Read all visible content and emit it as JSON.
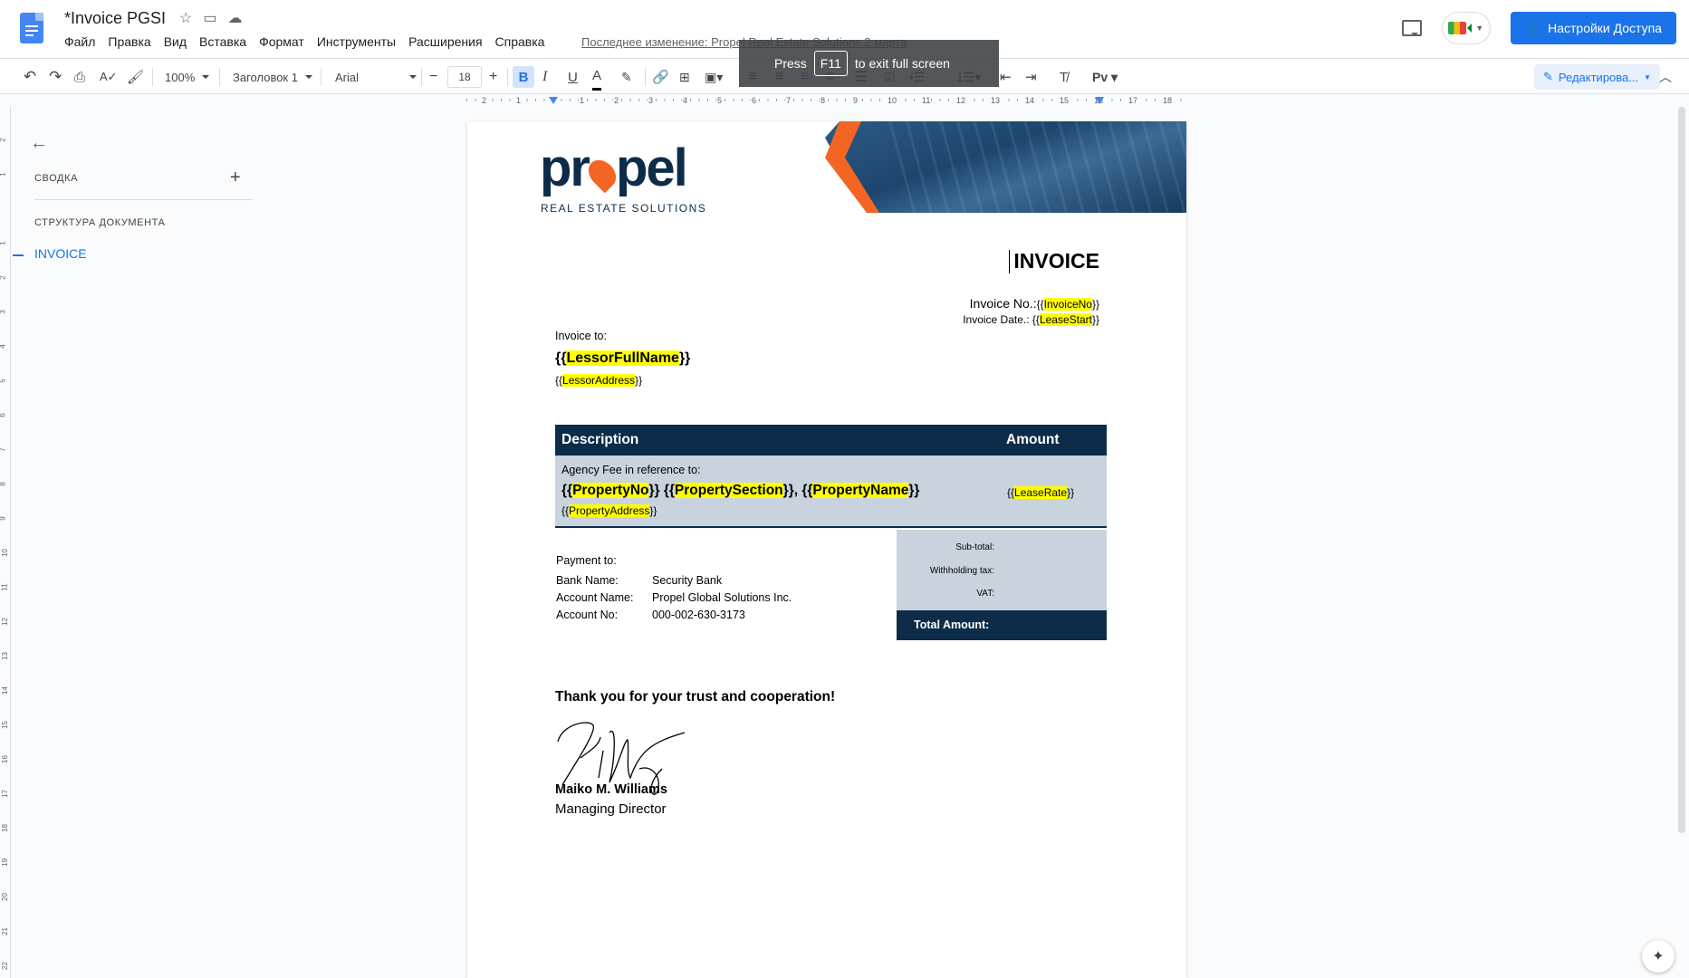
{
  "header": {
    "doc_title": "*Invoice PGSI",
    "menu": [
      "Файл",
      "Правка",
      "Вид",
      "Вставка",
      "Формат",
      "Инструменты",
      "Расширения",
      "Справка"
    ],
    "last_edit": "Последнее изменение: Propel Real Estate Solutions 2 марта",
    "share_label": "Настройки Доступа"
  },
  "toast": {
    "press": "Press",
    "key": "F11",
    "rest": "to exit full screen"
  },
  "toolbar": {
    "zoom": "100%",
    "style": "Заголовок 1",
    "font": "Arial",
    "font_size": "18",
    "bold": "B",
    "italic": "I",
    "underline": "U",
    "text_color": "A",
    "edit_mode": "Редактирова..."
  },
  "ruler_numbers": [
    "2",
    "1",
    "1",
    "2",
    "3",
    "4",
    "5",
    "6",
    "7",
    "8",
    "9",
    "10",
    "11",
    "12",
    "13",
    "14",
    "15",
    "16",
    "17",
    "18"
  ],
  "vruler_numbers": [
    "2",
    "1",
    "1",
    "2",
    "3",
    "4",
    "5",
    "6",
    "7",
    "8",
    "9",
    "10",
    "11",
    "12",
    "13",
    "14",
    "15",
    "16",
    "17",
    "18",
    "19",
    "20",
    "21",
    "22"
  ],
  "sidebar": {
    "summary": "СВОДКА",
    "structure": "СТРУКТУРА ДОКУМЕНТА",
    "items": [
      {
        "label": "INVOICE"
      }
    ]
  },
  "document": {
    "logo_text_a": "pr",
    "logo_text_b": "pel",
    "logo_sub": "REAL ESTATE SOLUTIONS",
    "title": "INVOICE",
    "invoice_no_label": "Invoice No.:",
    "invoice_no_var": "InvoiceNo",
    "invoice_date_label": "Invoice Date.: ",
    "invoice_date_var": "LeaseStart",
    "invoice_to": "Invoice to:",
    "lessor_name_var": "LessorFullName",
    "lessor_addr_var": "LessorAddress",
    "table": {
      "col_description": "Description",
      "col_amount": "Amount",
      "agency_text": "Agency Fee in reference to:",
      "property_no_var": "PropertyNo",
      "property_section_var": "PropertySection",
      "property_name_var": "PropertyName",
      "property_address_var": "PropertyAddress",
      "lease_rate_var": "LeaseRate"
    },
    "totals": {
      "subtotal": "Sub-total:",
      "withholding": "Withholding tax:",
      "vat": "VAT:",
      "total": "Total Amount:"
    },
    "payment": {
      "title": "Payment to:",
      "rows": [
        {
          "label": "Bank Name:",
          "value": "Security Bank"
        },
        {
          "label": "Account Name:",
          "value": "Propel Global Solutions Inc."
        },
        {
          "label": "Account No:",
          "value": "000-002-630-3173"
        }
      ]
    },
    "thanks": "Thank you for your trust and cooperation!",
    "signer_name": "Maiko M. Williams",
    "signer_role": "Managing Director"
  },
  "colors": {
    "accent": "#1a73e8",
    "navy": "#0d2c4a",
    "orange": "#f26522",
    "row_bg": "#c9d3dd",
    "highlight": "#ffff00"
  }
}
